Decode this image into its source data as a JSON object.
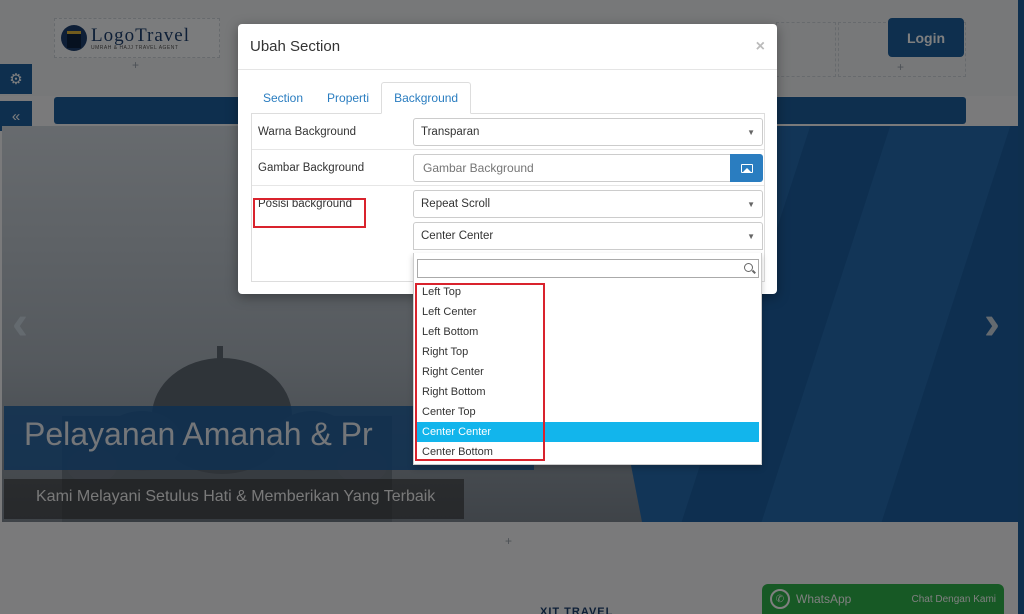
{
  "site": {
    "logo_title": "LogoTravel",
    "logo_subtitle": "UMRAH & HAJJ TRAVEL AGENT",
    "login_label": "Login",
    "hero_title": "Pelayanan Amanah & Pr",
    "hero_subtitle": "Kami Melayani Setulus Hati & Memberikan Yang Terbaik",
    "footer_text": "XIT TRAVEL",
    "whatsapp_label": "WhatsApp",
    "whatsapp_chat": "Chat Dengan Kami"
  },
  "modal": {
    "title": "Ubah Section",
    "close_symbol": "×",
    "tabs": [
      {
        "label": "Section"
      },
      {
        "label": "Properti"
      },
      {
        "label": "Background",
        "active": true
      }
    ],
    "fields": {
      "warna_label": "Warna Background",
      "warna_value": "Transparan",
      "gambar_label": "Gambar Background",
      "gambar_placeholder": "Gambar Background",
      "posisi_label": "Posisi background",
      "posisi_value": "Repeat Scroll",
      "posisi2_value": "Center Center"
    }
  },
  "dropdown": {
    "search_value": "",
    "options": [
      {
        "label": "Left Top"
      },
      {
        "label": "Left Center"
      },
      {
        "label": "Left Bottom"
      },
      {
        "label": "Right Top"
      },
      {
        "label": "Right Center"
      },
      {
        "label": "Right Bottom"
      },
      {
        "label": "Center Top"
      },
      {
        "label": "Center Center",
        "selected": true
      },
      {
        "label": "Center Bottom"
      }
    ],
    "selected_color": "#12b5ec"
  },
  "colors": {
    "primary": "#1c5f9c",
    "highlight": "#d9232d",
    "whatsapp": "#2eb34a"
  },
  "icons": {
    "gear": "gear-icon",
    "collapse": "double-chevron-left-icon",
    "image": "image-icon",
    "search": "search-icon",
    "whatsapp": "whatsapp-icon"
  }
}
